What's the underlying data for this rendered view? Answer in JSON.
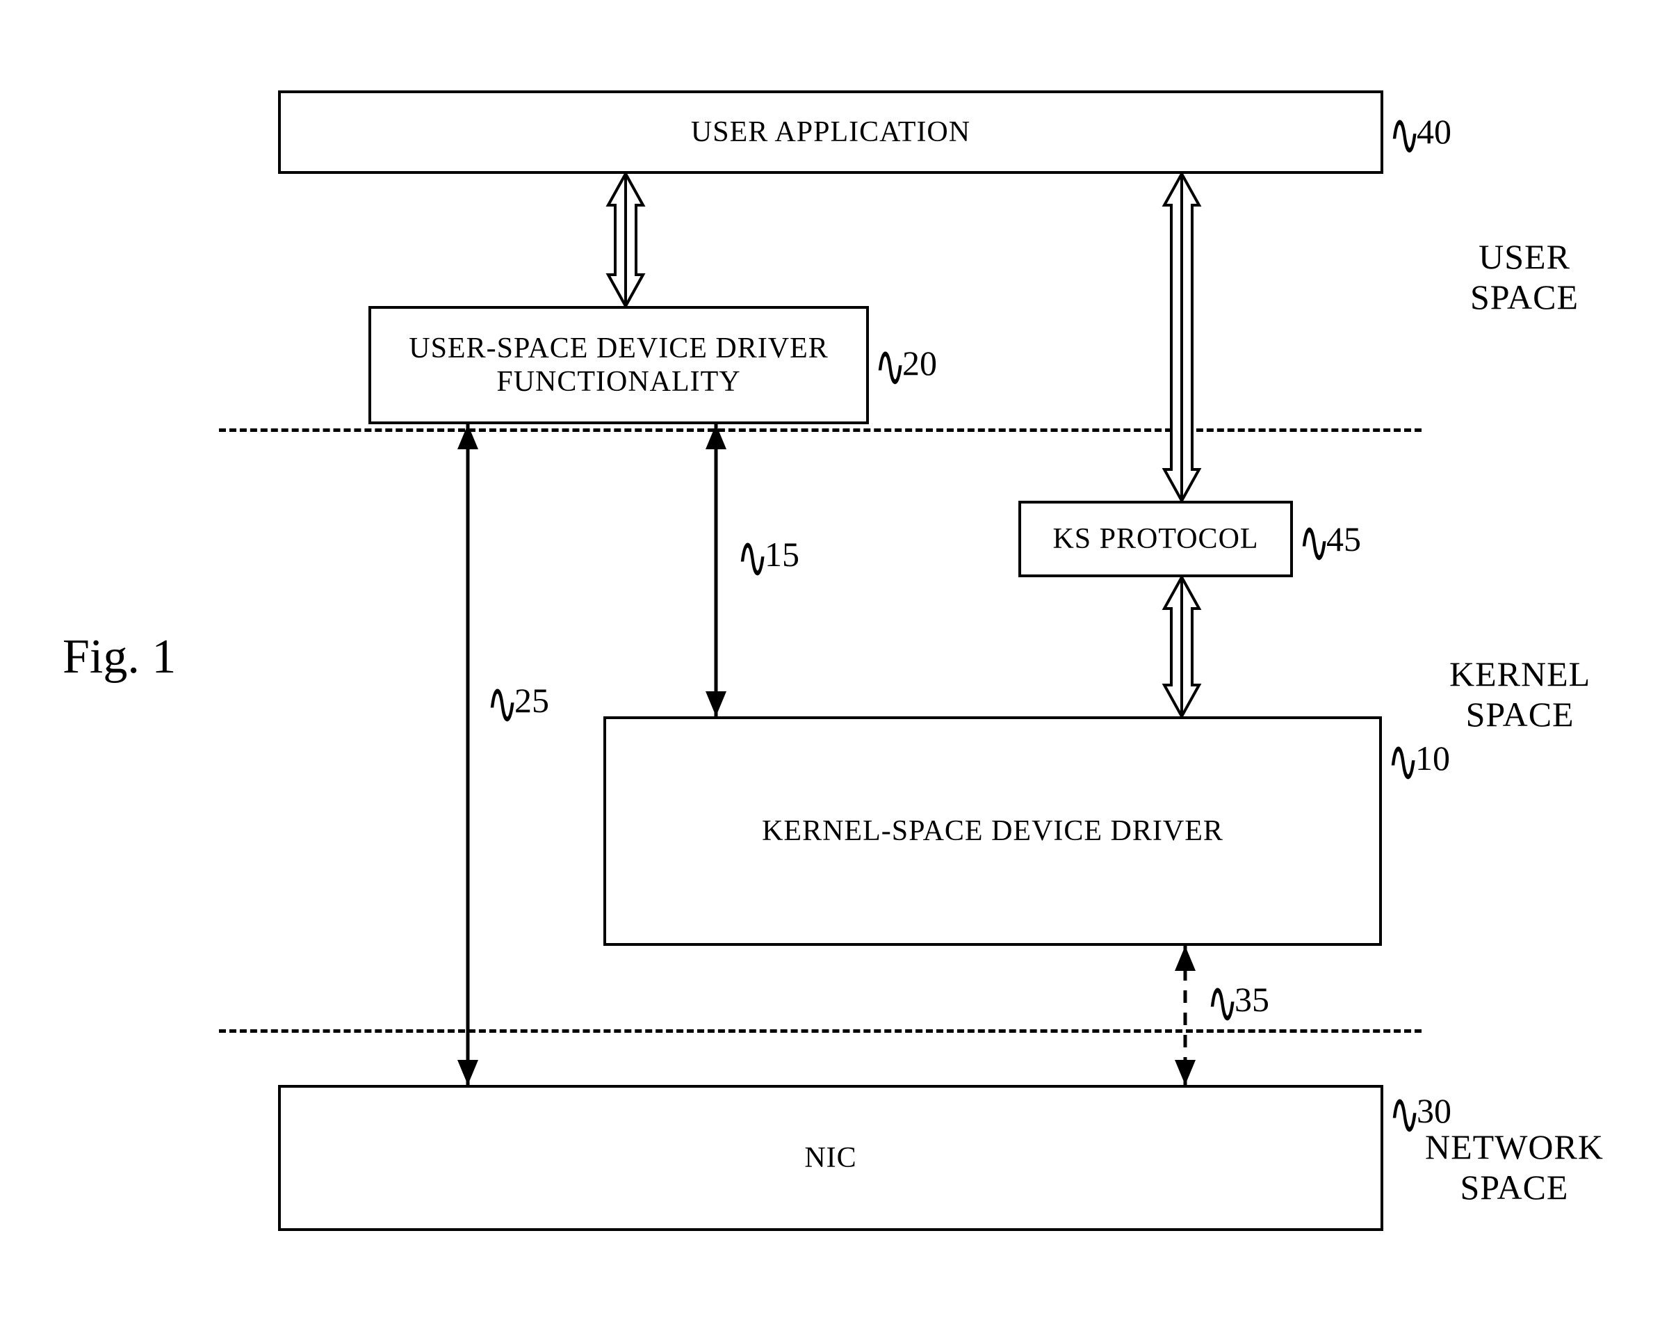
{
  "figure": {
    "label": "Fig. 1"
  },
  "boxes": {
    "user_app": {
      "label": "USER APPLICATION",
      "ref": "40"
    },
    "user_space_driver": {
      "label": "USER-SPACE DEVICE DRIVER\nFUNCTIONALITY",
      "ref": "20"
    },
    "ks_protocol": {
      "label": "KS PROTOCOL",
      "ref": "45"
    },
    "kernel_driver": {
      "label": "KERNEL-SPACE DEVICE DRIVER",
      "ref": "10"
    },
    "nic": {
      "label": "NIC",
      "ref": "30"
    }
  },
  "regions": {
    "user_space": "USER\nSPACE",
    "kernel_space": "KERNEL\nSPACE",
    "network_space": "NETWORK\nSPACE"
  },
  "arrows": {
    "a15": "15",
    "a25": "25",
    "a35": "35"
  }
}
